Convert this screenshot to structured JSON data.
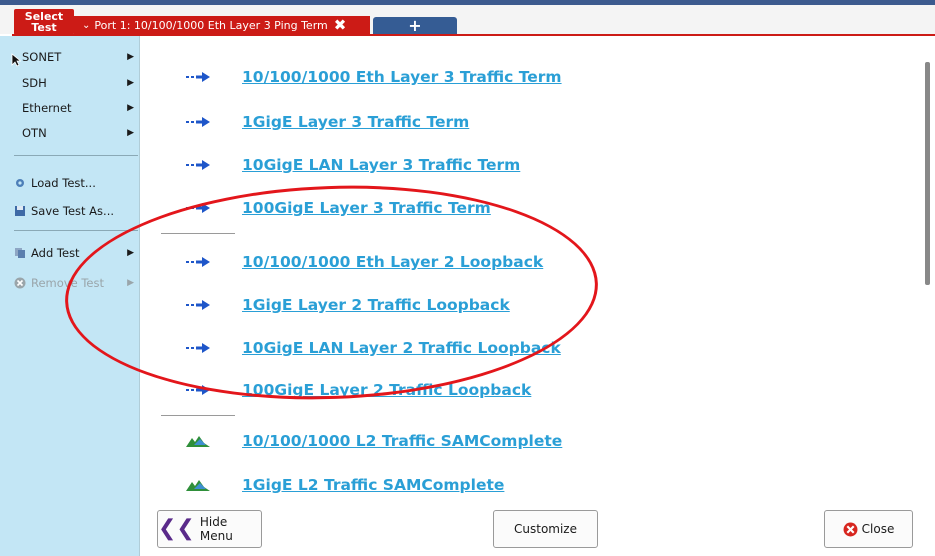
{
  "header": {
    "select_test_line1": "Select",
    "select_test_line2": "Test",
    "tab_label": "Port 1: 10/100/1000 Eth Layer 3 Ping Term",
    "add_tab": "+"
  },
  "sidebar": {
    "items": [
      {
        "label": "SONET"
      },
      {
        "label": "SDH"
      },
      {
        "label": "Ethernet"
      },
      {
        "label": "OTN"
      },
      {
        "label": "Load Test..."
      },
      {
        "label": "Save Test As..."
      },
      {
        "label": "Add Test"
      },
      {
        "label": "Remove Test"
      }
    ]
  },
  "tests": [
    {
      "label": "10/100/1000 Eth Layer 3 Traffic Term",
      "icon": "traffic-arrow-icon"
    },
    {
      "label": "1GigE Layer 3 Traffic Term",
      "icon": "traffic-arrow-icon"
    },
    {
      "label": "10GigE LAN Layer 3 Traffic Term",
      "icon": "traffic-arrow-icon"
    },
    {
      "label": "100GigE Layer 3 Traffic Term",
      "icon": "traffic-arrow-icon"
    },
    {
      "label": "10/100/1000 Eth Layer 2 Loopback",
      "icon": "traffic-arrow-icon"
    },
    {
      "label": "1GigE Layer 2 Traffic Loopback",
      "icon": "traffic-arrow-icon"
    },
    {
      "label": "10GigE LAN Layer 2 Traffic Loopback",
      "icon": "traffic-arrow-icon"
    },
    {
      "label": "100GigE Layer 2 Traffic Loopback",
      "icon": "traffic-arrow-icon"
    },
    {
      "label": "10/100/1000 L2 Traffic SAMComplete",
      "icon": "samcomplete-icon"
    },
    {
      "label": "1GigE L2 Traffic SAMComplete",
      "icon": "samcomplete-icon"
    }
  ],
  "footer": {
    "hide_menu": "Hide Menu",
    "customize": "Customize",
    "close": "Close"
  },
  "colors": {
    "accent_red": "#cc1b16",
    "link_blue": "#2a9fd6",
    "sidebar_bg": "#c3e6f5",
    "annotation_red": "#e3161b"
  }
}
